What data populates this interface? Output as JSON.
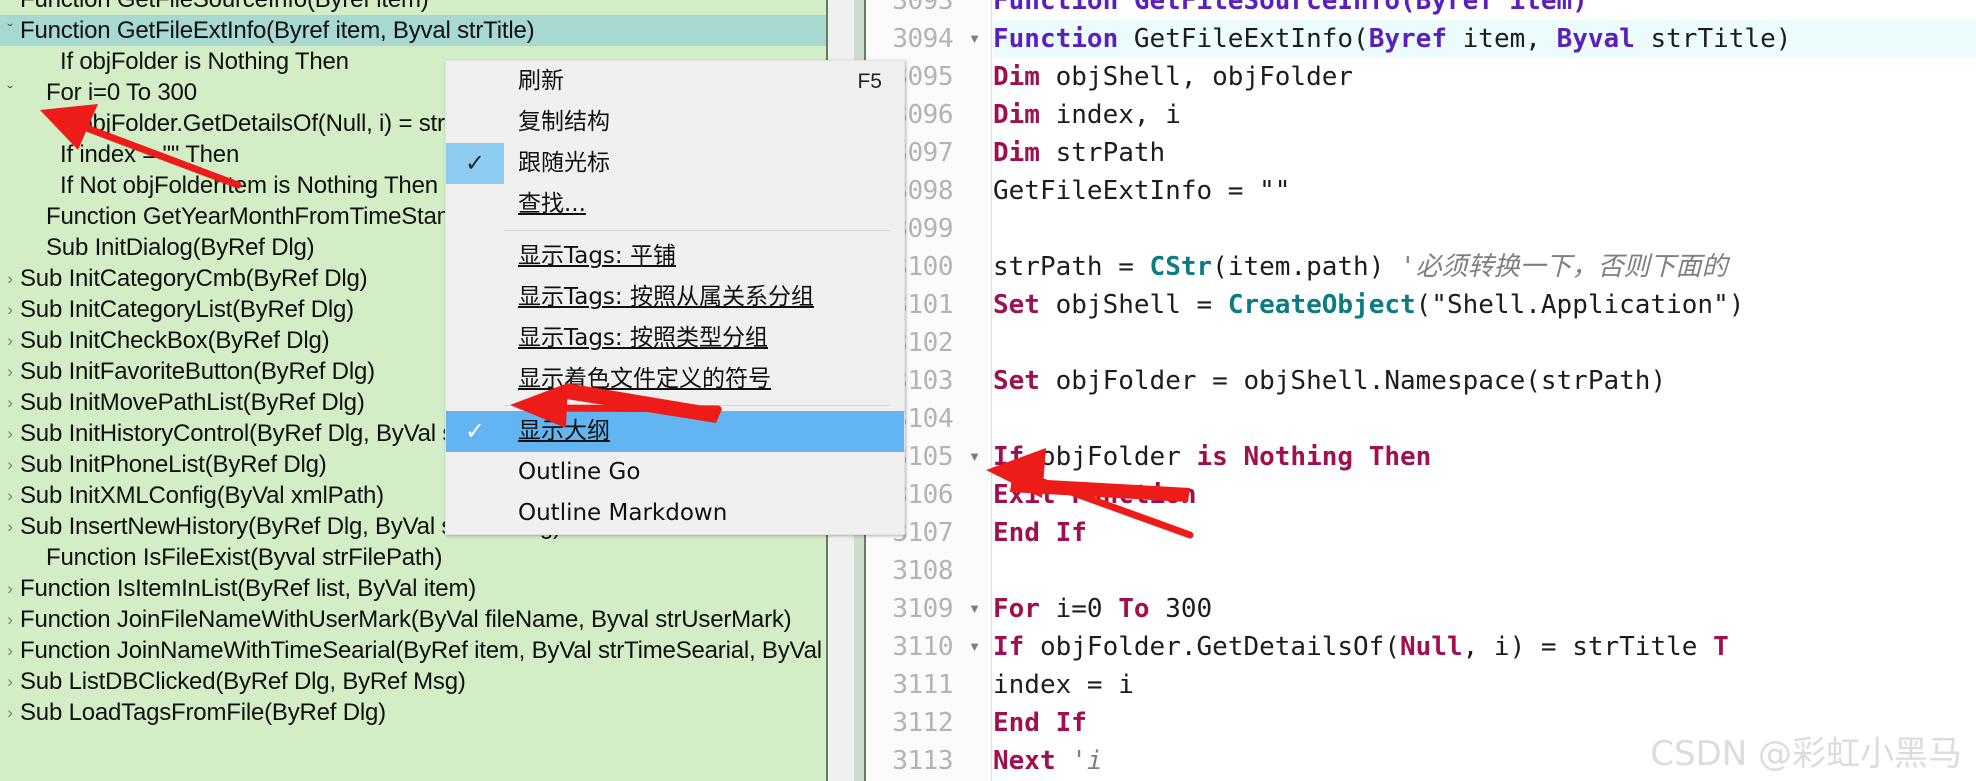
{
  "outline": {
    "panel_name": "symbol-outline-tree",
    "bg_color": "#d3eec6",
    "selected_color": "#a7d8d2",
    "items": [
      {
        "text": "Function GetFileSourceInfo(Byref item)",
        "chev": "down",
        "indent": 0,
        "selected": false,
        "clipped_top": true
      },
      {
        "text": "Function GetFileExtInfo(Byref item, Byval strTitle)",
        "chev": "down",
        "indent": 0,
        "selected": true
      },
      {
        "text": "If objFolder is Nothing Then",
        "chev": "none",
        "indent": 2,
        "selected": false
      },
      {
        "text": "For i=0 To 300",
        "chev": "down",
        "indent": 1,
        "selected": false
      },
      {
        "text": "If objFolder.GetDetailsOf(Null, i) = strTitle Then",
        "chev": "none",
        "indent": 2,
        "selected": false
      },
      {
        "text": "If index = \"\" Then",
        "chev": "none",
        "indent": 2,
        "selected": false
      },
      {
        "text": "If Not objFolderItem is Nothing Then",
        "chev": "none",
        "indent": 2,
        "selected": false
      },
      {
        "text": "Function GetYearMonthFromTimeStamp(Byval strTimeStamp)",
        "chev": "none",
        "indent": 1,
        "selected": false
      },
      {
        "text": "Sub InitDialog(ByRef Dlg)",
        "chev": "none",
        "indent": 1,
        "selected": false
      },
      {
        "text": "Sub InitCategoryCmb(ByRef Dlg)",
        "chev": "right",
        "indent": 0,
        "selected": false
      },
      {
        "text": "Sub InitCategoryList(ByRef Dlg)",
        "chev": "right",
        "indent": 0,
        "selected": false
      },
      {
        "text": "Sub InitCheckBox(ByRef Dlg)",
        "chev": "right",
        "indent": 0,
        "selected": false
      },
      {
        "text": "Sub InitFavoriteButton(ByRef Dlg)",
        "chev": "right",
        "indent": 0,
        "selected": false
      },
      {
        "text": "Sub InitMovePathList(ByRef Dlg)",
        "chev": "right",
        "indent": 0,
        "selected": false
      },
      {
        "text": "Sub InitHistoryControl(ByRef Dlg, ByVal strHistory)",
        "chev": "right",
        "indent": 0,
        "selected": false
      },
      {
        "text": "Sub InitPhoneList(ByRef Dlg)",
        "chev": "right",
        "indent": 0,
        "selected": false
      },
      {
        "text": "Sub InitXMLConfig(ByVal xmlPath)",
        "chev": "right",
        "indent": 0,
        "selected": false
      },
      {
        "text": "Sub InsertNewHistory(ByRef Dlg, ByVal strNewTag)",
        "chev": "right",
        "indent": 0,
        "selected": false
      },
      {
        "text": "Function IsFileExist(Byval strFilePath)",
        "chev": "none",
        "indent": 1,
        "selected": false
      },
      {
        "text": "Function IsItemInList(ByRef list, ByVal item)",
        "chev": "right",
        "indent": 0,
        "selected": false
      },
      {
        "text": "Function JoinFileNameWithUserMark(ByVal fileName, Byval strUserMark)",
        "chev": "right",
        "indent": 0,
        "selected": false
      },
      {
        "text": "Function JoinNameWithTimeSearial(ByRef item, ByVal strTimeSearial, ByVal n)",
        "chev": "right",
        "indent": 0,
        "selected": false
      },
      {
        "text": "Sub ListDBClicked(ByRef Dlg, ByRef Msg)",
        "chev": "right",
        "indent": 0,
        "selected": false
      },
      {
        "text": "Sub LoadTagsFromFile(ByRef Dlg)",
        "chev": "right",
        "indent": 0,
        "selected": false
      }
    ]
  },
  "context_menu": {
    "name": "outline-context-menu",
    "bg_color": "#f0f0f0",
    "check_highlight_color": "#8ecbf0",
    "row_highlight_color": "#62b5f0",
    "groups": [
      {
        "items": [
          {
            "label": "刷新",
            "accel": "F5",
            "checked": false,
            "highlighted": false,
            "underlined": false
          },
          {
            "label": "复制结构",
            "accel": "",
            "checked": false,
            "highlighted": false,
            "underlined": false
          },
          {
            "label": "跟随光标",
            "accel": "",
            "checked": true,
            "highlighted": false,
            "underlined": false
          },
          {
            "label": "查找...",
            "accel": "",
            "checked": false,
            "highlighted": false,
            "underlined": true
          }
        ]
      },
      {
        "items": [
          {
            "label": "显示Tags: 平铺",
            "accel": "",
            "checked": false,
            "highlighted": false,
            "underlined": true
          },
          {
            "label": "显示Tags: 按照从属关系分组",
            "accel": "",
            "checked": false,
            "highlighted": false,
            "underlined": true
          },
          {
            "label": "显示Tags: 按照类型分组",
            "accel": "",
            "checked": false,
            "highlighted": false,
            "underlined": true
          },
          {
            "label": "显示着色文件定义的符号",
            "accel": "",
            "checked": false,
            "highlighted": false,
            "underlined": true
          }
        ]
      },
      {
        "items": [
          {
            "label": "显示大纲",
            "accel": "",
            "checked": true,
            "highlighted": true,
            "underlined": true
          },
          {
            "label": "Outline Go",
            "accel": "",
            "checked": false,
            "highlighted": false,
            "underlined": false
          },
          {
            "label": "Outline Markdown",
            "accel": "",
            "checked": false,
            "highlighted": false,
            "underlined": false
          }
        ]
      }
    ]
  },
  "editor": {
    "name": "code-editor",
    "language": "VBScript",
    "current_line_color": "#ecfbfb",
    "lines": [
      {
        "num": "3093",
        "fold": "",
        "current": false,
        "clipped": true,
        "tokens": [
          {
            "t": "    ",
            "c": "plain"
          },
          {
            "t": "Function GetFileSourceInfo(Byref item)",
            "c": "kwb"
          }
        ]
      },
      {
        "num": "3094",
        "fold": "down",
        "current": true,
        "tokens": [
          {
            "t": "Function ",
            "c": "kwb"
          },
          {
            "t": "GetFileExtInfo(",
            "c": "plain"
          },
          {
            "t": "Byref",
            "c": "kwb"
          },
          {
            "t": " item, ",
            "c": "plain"
          },
          {
            "t": "Byval",
            "c": "kwb"
          },
          {
            "t": " strTitle)",
            "c": "plain"
          }
        ]
      },
      {
        "num": "3095",
        "fold": "",
        "current": false,
        "tokens": [
          {
            "t": "    ",
            "c": "plain"
          },
          {
            "t": "Dim",
            "c": "kw"
          },
          {
            "t": " objShell, objFolder",
            "c": "plain"
          }
        ]
      },
      {
        "num": "3096",
        "fold": "",
        "current": false,
        "tokens": [
          {
            "t": "    ",
            "c": "plain"
          },
          {
            "t": "Dim",
            "c": "kw"
          },
          {
            "t": " index, i",
            "c": "plain"
          }
        ]
      },
      {
        "num": "3097",
        "fold": "",
        "current": false,
        "tokens": [
          {
            "t": "    ",
            "c": "plain"
          },
          {
            "t": "Dim",
            "c": "kw"
          },
          {
            "t": " strPath",
            "c": "plain"
          }
        ]
      },
      {
        "num": "3098",
        "fold": "",
        "current": false,
        "tokens": [
          {
            "t": "    GetFileExtInfo = \"\"",
            "c": "plain"
          }
        ]
      },
      {
        "num": "3099",
        "fold": "",
        "current": false,
        "tokens": []
      },
      {
        "num": "3100",
        "fold": "",
        "current": false,
        "tokens": [
          {
            "t": "    strPath = ",
            "c": "plain"
          },
          {
            "t": "CStr",
            "c": "fn"
          },
          {
            "t": "(item.path) ",
            "c": "plain"
          },
          {
            "t": "'必须转换一下，否则下面的",
            "c": "cmt"
          }
        ]
      },
      {
        "num": "3101",
        "fold": "",
        "current": false,
        "tokens": [
          {
            "t": "    ",
            "c": "plain"
          },
          {
            "t": "Set",
            "c": "kw"
          },
          {
            "t": " objShell = ",
            "c": "plain"
          },
          {
            "t": "CreateObject",
            "c": "fn"
          },
          {
            "t": "(\"Shell.Application\")",
            "c": "plain"
          }
        ]
      },
      {
        "num": "3102",
        "fold": "",
        "current": false,
        "tokens": []
      },
      {
        "num": "3103",
        "fold": "",
        "current": false,
        "tokens": [
          {
            "t": "    ",
            "c": "plain"
          },
          {
            "t": "Set",
            "c": "kw"
          },
          {
            "t": " objFolder = objShell.Namespace(strPath)",
            "c": "plain"
          }
        ]
      },
      {
        "num": "3104",
        "fold": "",
        "current": false,
        "tokens": []
      },
      {
        "num": "3105",
        "fold": "down",
        "current": false,
        "tokens": [
          {
            "t": "    ",
            "c": "plain"
          },
          {
            "t": "If",
            "c": "kw"
          },
          {
            "t": " objFolder ",
            "c": "plain"
          },
          {
            "t": "is Nothing",
            "c": "kw"
          },
          {
            "t": " ",
            "c": "plain"
          },
          {
            "t": "Then",
            "c": "kw"
          }
        ]
      },
      {
        "num": "3106",
        "fold": "",
        "current": false,
        "tokens": [
          {
            "t": "        ",
            "c": "plain"
          },
          {
            "t": "Exit Function",
            "c": "kw"
          }
        ]
      },
      {
        "num": "3107",
        "fold": "",
        "current": false,
        "tokens": [
          {
            "t": "    ",
            "c": "plain"
          },
          {
            "t": "End If",
            "c": "kw"
          }
        ]
      },
      {
        "num": "3108",
        "fold": "",
        "current": false,
        "tokens": []
      },
      {
        "num": "3109",
        "fold": "down",
        "current": false,
        "tokens": [
          {
            "t": "    ",
            "c": "plain"
          },
          {
            "t": "For",
            "c": "kw"
          },
          {
            "t": " i=0 ",
            "c": "plain"
          },
          {
            "t": "To",
            "c": "kw"
          },
          {
            "t": " 300",
            "c": "plain"
          }
        ]
      },
      {
        "num": "3110",
        "fold": "down",
        "current": false,
        "tokens": [
          {
            "t": "        ",
            "c": "plain"
          },
          {
            "t": "If",
            "c": "kw"
          },
          {
            "t": " objFolder.GetDetailsOf(",
            "c": "plain"
          },
          {
            "t": "Null",
            "c": "kw"
          },
          {
            "t": ", i) = strTitle ",
            "c": "plain"
          },
          {
            "t": "T",
            "c": "kw"
          }
        ]
      },
      {
        "num": "3111",
        "fold": "",
        "current": false,
        "tokens": [
          {
            "t": "            index = i",
            "c": "plain"
          }
        ]
      },
      {
        "num": "3112",
        "fold": "",
        "current": false,
        "tokens": [
          {
            "t": "        ",
            "c": "plain"
          },
          {
            "t": "End If",
            "c": "kw"
          }
        ]
      },
      {
        "num": "3113",
        "fold": "",
        "current": false,
        "tokens": [
          {
            "t": "    ",
            "c": "plain"
          },
          {
            "t": "Next",
            "c": "kw"
          },
          {
            "t": " ",
            "c": "plain"
          },
          {
            "t": "'i",
            "c": "cmt"
          }
        ]
      }
    ]
  },
  "annotations": {
    "name": "red-arrow-annotations",
    "color": "#ee1c18",
    "count": 3
  },
  "watermark": {
    "text": "CSDN @彩虹小黑马",
    "color": "#dcdcdc"
  }
}
